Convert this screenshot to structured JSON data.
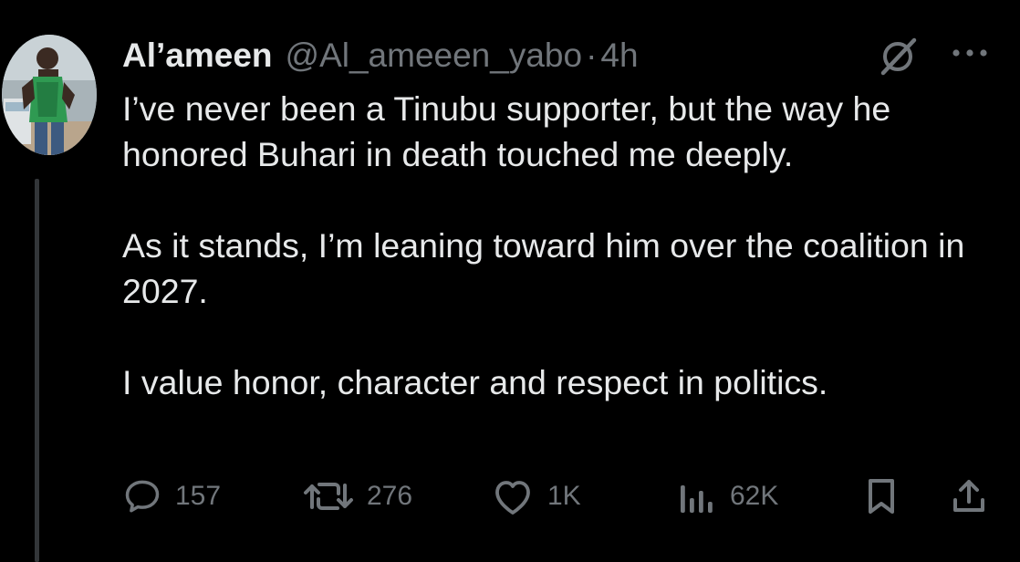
{
  "tweet": {
    "author_name": "Al’ameen",
    "handle": "@Al_ameeen_yabo",
    "separator": "·",
    "time": "4h",
    "paragraphs": [
      "I’ve never been a Tinubu supporter, but the way he honored Buhari in death touched me deeply.",
      "As it stands, I’m leaning toward him over the coalition in 2027.",
      "I value honor, character and respect in politics."
    ],
    "replies": "157",
    "reposts": "276",
    "likes": "1K",
    "views": "62K"
  },
  "icons": {
    "avatar": "profile-photo",
    "grok": "grok-icon",
    "more": "more-options-icon",
    "reply": "reply-icon",
    "repost": "repost-icon",
    "like": "heart-icon",
    "views": "views-icon",
    "bookmark": "bookmark-icon",
    "share": "share-icon"
  },
  "colors": {
    "background": "#000000",
    "primary_text": "#e7e9ea",
    "secondary_text": "#71767b"
  }
}
